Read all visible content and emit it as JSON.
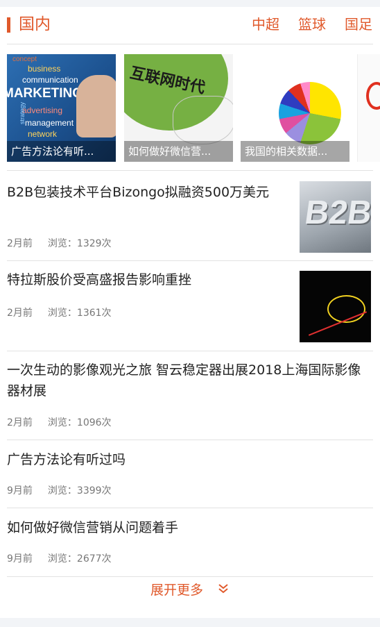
{
  "header": {
    "title": "国内",
    "tabs": [
      "中超",
      "篮球",
      "国足"
    ]
  },
  "carousel": [
    {
      "caption": "广告方法论有听...",
      "image": "marketing-keywords-image",
      "words": [
        "concept",
        "business",
        "communication",
        "MARKETING",
        "advertising",
        "management",
        "network",
        "strategy"
      ]
    },
    {
      "caption": "如何做好微信营...",
      "image": "internet-era-image",
      "text": "互联网时代"
    },
    {
      "caption": "我国的相关数据...",
      "image": "pie-chart-image"
    },
    {
      "caption": "",
      "image": "partial-image"
    }
  ],
  "news": [
    {
      "title": "B2B包装技术平台Bizongo拟融资500万美元",
      "time": "2月前",
      "views": "浏览：1329次",
      "image": "b2b-image",
      "image_text": "B2B"
    },
    {
      "title": "特拉斯股价受高盛报告影响重挫",
      "time": "2月前",
      "views": "浏览：1361次",
      "image": "stock-chart-image"
    },
    {
      "title": "一次生动的影像观光之旅 智云稳定器出展2018上海国际影像器材展",
      "time": "2月前",
      "views": "浏览：1096次"
    },
    {
      "title": "广告方法论有听过吗",
      "time": "9月前",
      "views": "浏览：3399次"
    },
    {
      "title": "如何做好微信营销从问题着手",
      "time": "9月前",
      "views": "浏览：2677次"
    }
  ],
  "more_label": "展开更多",
  "colors": {
    "accent": "#e0592b",
    "text": "#222222",
    "meta": "#777777",
    "divider": "#e2e2e2",
    "page_bg": "#f2f4f7"
  }
}
